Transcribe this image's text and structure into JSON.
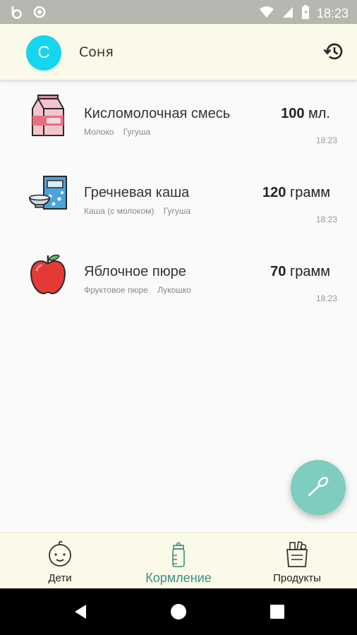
{
  "status": {
    "time": "18:23"
  },
  "header": {
    "avatar_letter": "С",
    "child_name": "Соня"
  },
  "feedings": [
    {
      "name": "Кисломолочная смесь",
      "category": "Молоко",
      "brand": "Гугуша",
      "amount_value": "100",
      "amount_unit": "мл.",
      "time": "18:23",
      "icon": "milk-carton-icon"
    },
    {
      "name": "Гречневая каша",
      "category": "Каша (с молоком)",
      "brand": "Гугуша",
      "amount_value": "120",
      "amount_unit": "грамм",
      "time": "18:23",
      "icon": "cereal-box-icon"
    },
    {
      "name": "Яблочное пюре",
      "category": "Фруктовое пюре",
      "brand": "Лукошко",
      "amount_value": "70",
      "amount_unit": "грамм",
      "time": "18:23",
      "icon": "apple-icon"
    }
  ],
  "bottom_nav": {
    "kids_label": "Дети",
    "feeding_label": "Кормление",
    "products_label": "Продукты"
  },
  "colors": {
    "accent": "#7ecdc0",
    "active_nav": "#3c8f86",
    "avatar": "#16d5ef",
    "bar_bg": "#fbf9e7"
  }
}
